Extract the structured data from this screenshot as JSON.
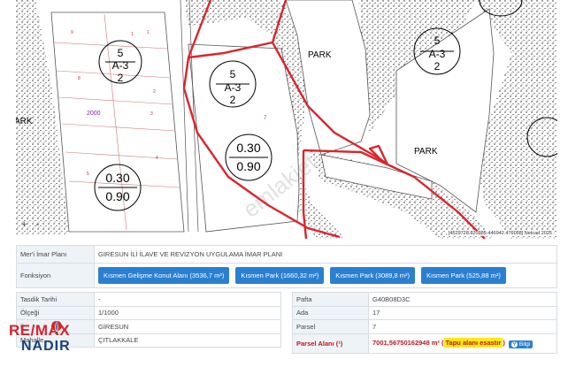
{
  "map": {
    "labels": {
      "park": "PARK",
      "ark": "ARK",
      "code_purple": "2000",
      "parcel_7": "7"
    },
    "zoning": {
      "a": {
        "top": "5",
        "mid": "A-3",
        "bot": "2"
      },
      "ratio_a": {
        "top": "0.30",
        "bot": "0.90"
      }
    },
    "zoom_in": "+",
    "zoom_out": "-",
    "coords": "[4529728.820385-446942.476058] Netcad 2025",
    "watermark": "emlakjet"
  },
  "plan": {
    "label": "Mer'i İmar Planı",
    "value": "GİRESUN İLİ İLAVE VE REVİZYON UYGULAMA İMAR PLANI"
  },
  "fonksiyon": {
    "label": "Fonksiyon",
    "buttons": [
      "Kısmen Gelişme Konut Alanı (3536,7 m²)",
      "Kısmen Park (1660,32 m²)",
      "Kısmen Park (3089,8 m²)",
      "Kısmen Park (525,88 m²)"
    ]
  },
  "left_table": [
    {
      "label": "Tasdik Tarihi",
      "value": "-"
    },
    {
      "label": "Ölçeği",
      "value": "1/1000"
    },
    {
      "label": "İl",
      "value": "GİRESUN"
    },
    {
      "label": "Mahalle",
      "value": "ÇITLAKKALE"
    }
  ],
  "right_table": {
    "rows": [
      {
        "label": "Pafta",
        "value": "G40B08D3C"
      },
      {
        "label": "Ada",
        "value": "17"
      },
      {
        "label": "Parsel",
        "value": "7"
      }
    ],
    "area": {
      "label": "Parsel Alanı (¹)",
      "value": "7001,56750162948 m²",
      "note_open": "(",
      "note": "Tapu alanı esastır",
      "note_close": ")",
      "info_button": "Bilgi"
    }
  },
  "logo": {
    "re": "RE/MAX",
    "nadir": "NADIR"
  },
  "colors": {
    "accent_blue": "#2b7fd0",
    "parcel_red": "#d9262c",
    "logo_red": "#d7232c",
    "logo_blue": "#17427c"
  }
}
